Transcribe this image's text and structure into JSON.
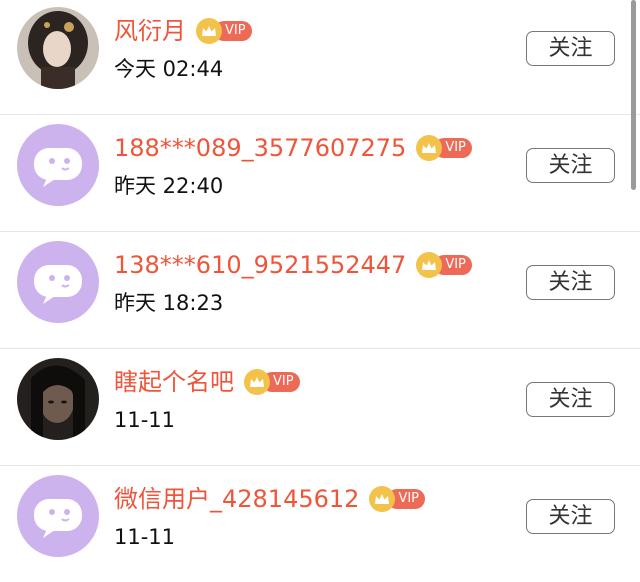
{
  "follow_label": "关注",
  "vip_label": "VIP",
  "users": [
    {
      "name": "风衍月",
      "time": "今天 02:44",
      "avatar": "photo-woman",
      "vip": true
    },
    {
      "name": "188***089_3577607275",
      "time": "昨天 22:40",
      "avatar": "default-chat",
      "vip": true
    },
    {
      "name": "138***610_9521552447",
      "time": "昨天 18:23",
      "avatar": "default-chat",
      "vip": true
    },
    {
      "name": "瞎起个名吧",
      "time": "11-11",
      "avatar": "photo-dark",
      "vip": true
    },
    {
      "name": "微信用户_428145612",
      "time": "11-11",
      "avatar": "default-chat",
      "vip": true
    }
  ],
  "colors": {
    "name": "#f0553a",
    "vip_pill": "#ec6a56",
    "crown": "#f3c24a",
    "default_avatar": "#cdb3ee"
  }
}
